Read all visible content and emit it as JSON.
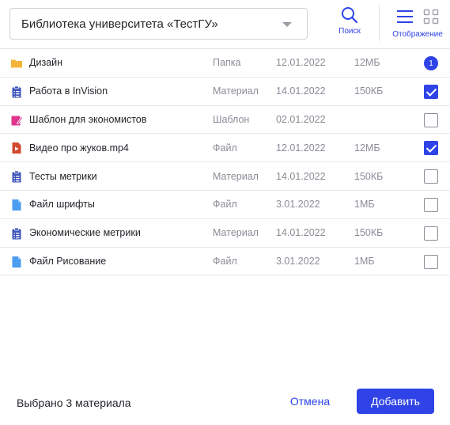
{
  "header": {
    "library_select": {
      "label": "Библиотека университета «ТестГУ»"
    },
    "search": {
      "label": "Поиск",
      "icon": "search-icon"
    },
    "view": {
      "label": "Отображение",
      "icons": [
        "list-view-icon",
        "grid-view-icon"
      ]
    }
  },
  "colors": {
    "accent": "#2f43e6",
    "folder": "#f5b43b",
    "material": "#3e55b8",
    "template": "#e0348f",
    "video": "#d24a2f",
    "file": "#4b9df0"
  },
  "rows": [
    {
      "icon": "folder-icon",
      "name": "Дизайн",
      "type": "Папка",
      "date": "12.01.2022",
      "size": "12МБ",
      "badge": "1"
    },
    {
      "icon": "clipboard-icon",
      "name": "Работа в InVision",
      "type": "Материал",
      "date": "14.01.2022",
      "size": "150КБ",
      "checked": true
    },
    {
      "icon": "template-icon",
      "name": "Шаблон для экономистов",
      "type": "Шаблон",
      "date": "02.01.2022",
      "size": "",
      "checked": false
    },
    {
      "icon": "video-file-icon",
      "name": "Видео про жуков.mp4",
      "type": "Файл",
      "date": "12.01.2022",
      "size": "12МБ",
      "checked": true
    },
    {
      "icon": "clipboard-icon",
      "name": "Тесты метрики",
      "type": "Материал",
      "date": "14.01.2022",
      "size": "150КБ",
      "checked": false
    },
    {
      "icon": "file-icon",
      "name": "Файл шрифты",
      "type": "Файл",
      "date": "3.01.2022",
      "size": "1МБ",
      "checked": false
    },
    {
      "icon": "clipboard-icon",
      "name": "Экономические метрики",
      "type": "Материал",
      "date": "14.01.2022",
      "size": "150КБ",
      "checked": false
    },
    {
      "icon": "file-icon",
      "name": "Файл Рисование",
      "type": "Файл",
      "date": "3.01.2022",
      "size": "1МБ",
      "checked": false
    }
  ],
  "footer": {
    "status": "Выбрано 3 материала",
    "cancel_label": "Отмена",
    "add_label": "Добавить"
  }
}
